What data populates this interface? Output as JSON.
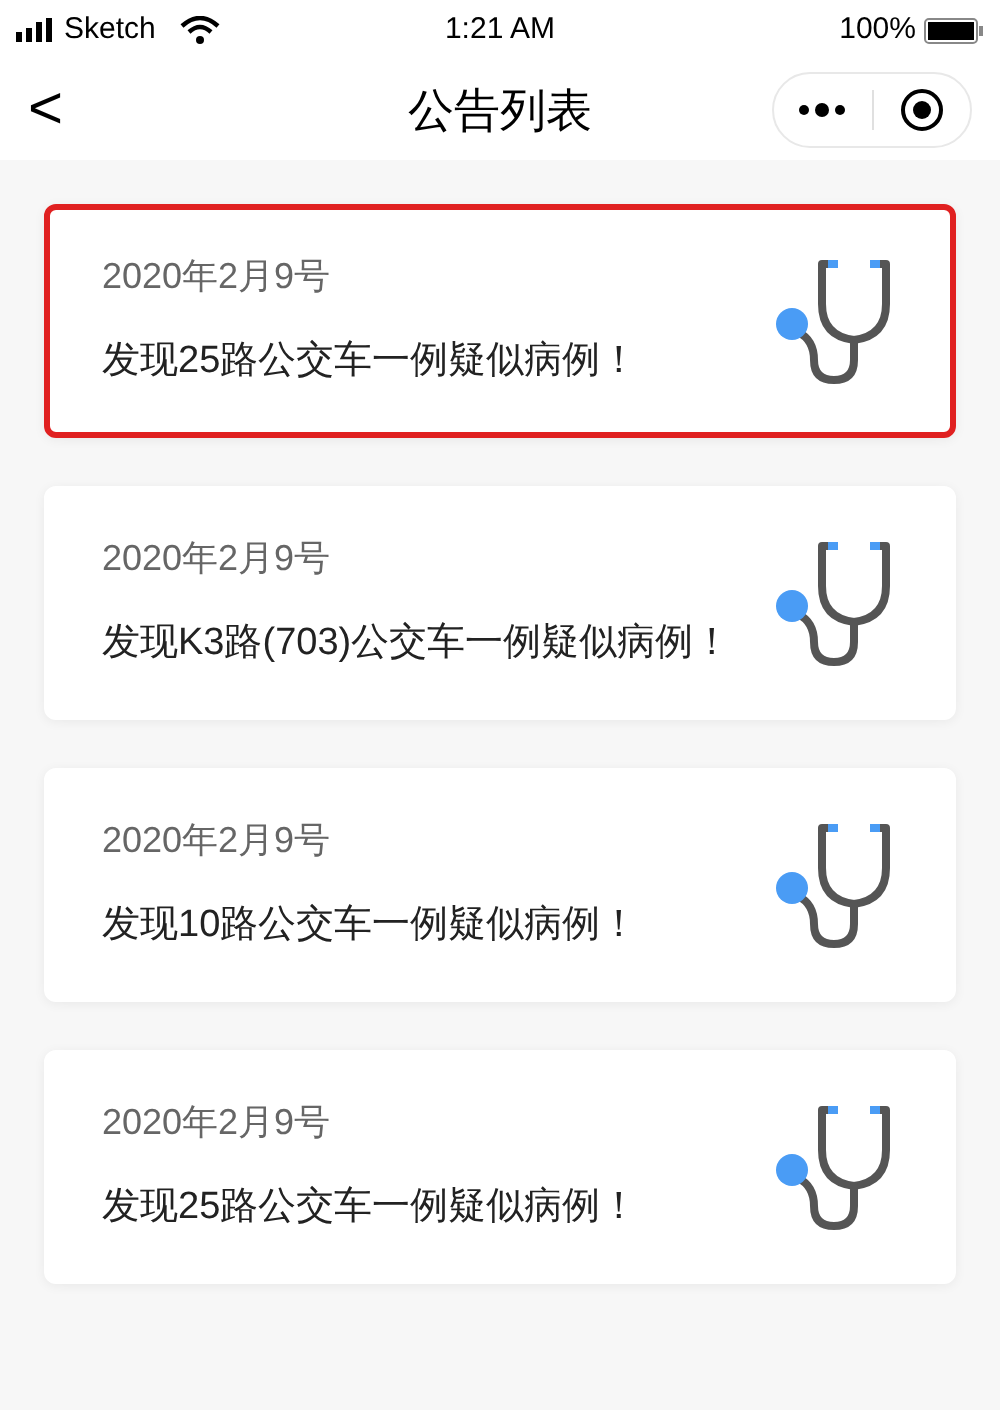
{
  "status_bar": {
    "carrier": "Sketch",
    "time": "1:21 AM",
    "battery": "100%"
  },
  "nav": {
    "back": "<",
    "title": "公告列表"
  },
  "notices": [
    {
      "date": "2020年2月9号",
      "title": "发现25路公交车一例疑似病例！",
      "selected": true
    },
    {
      "date": "2020年2月9号",
      "title": "发现K3路(703)公交车一例疑似病例！",
      "selected": false
    },
    {
      "date": "2020年2月9号",
      "title": "发现10路公交车一例疑似病例！",
      "selected": false
    },
    {
      "date": "2020年2月9号",
      "title": "发现25路公交车一例疑似病例！",
      "selected": false
    }
  ]
}
